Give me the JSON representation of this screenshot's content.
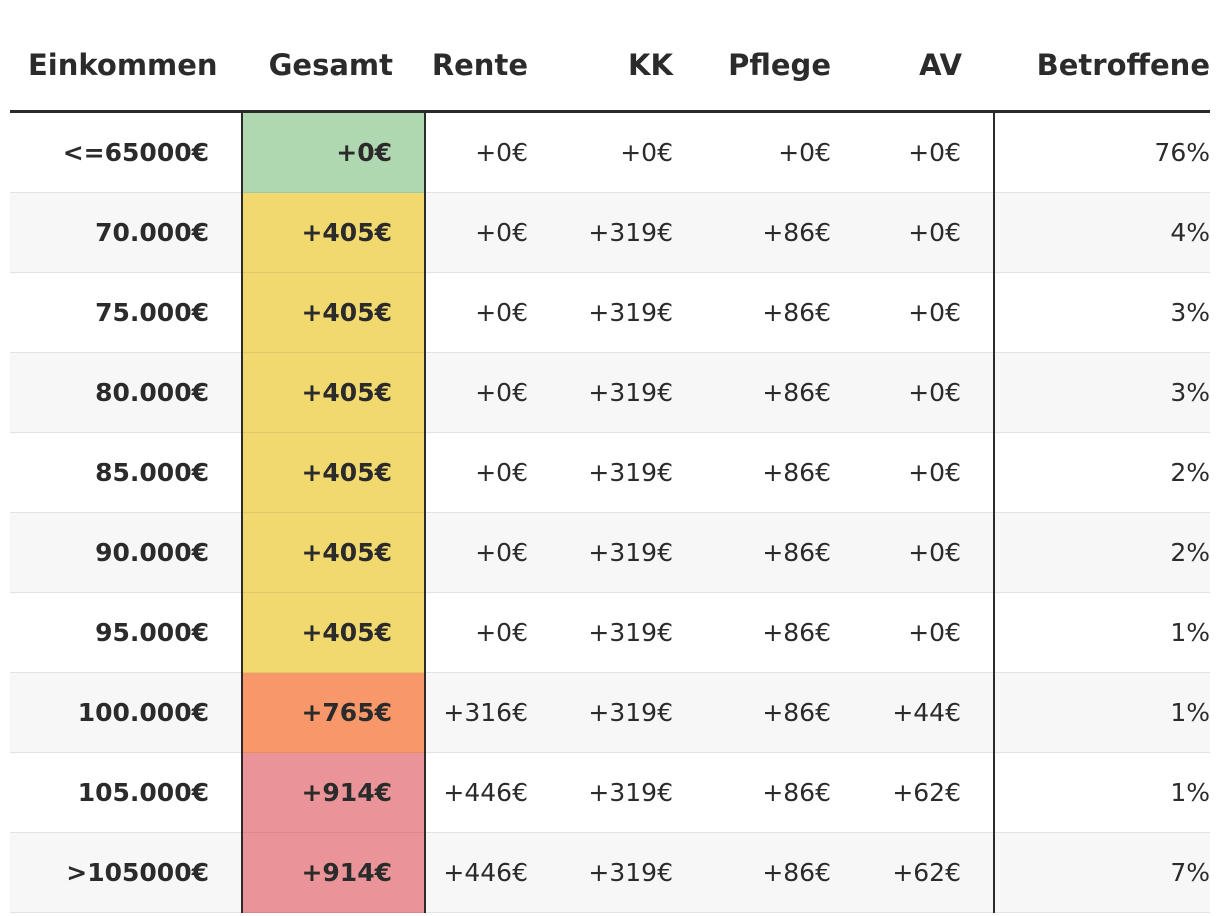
{
  "chart_data": {
    "type": "table",
    "columns": [
      "Einkommen",
      "Gesamt",
      "Rente",
      "KK",
      "Pflege",
      "AV",
      "Betroffene"
    ],
    "rows": [
      {
        "einkommen": "<=65000€",
        "gesamt": "+0€",
        "rente": "+0€",
        "kk": "+0€",
        "pflege": "+0€",
        "av": "+0€",
        "betroffene": "76%",
        "color": "#afd7b0"
      },
      {
        "einkommen": "70.000€",
        "gesamt": "+405€",
        "rente": "+0€",
        "kk": "+319€",
        "pflege": "+86€",
        "av": "+0€",
        "betroffene": "4%",
        "color": "#f1d86f"
      },
      {
        "einkommen": "75.000€",
        "gesamt": "+405€",
        "rente": "+0€",
        "kk": "+319€",
        "pflege": "+86€",
        "av": "+0€",
        "betroffene": "3%",
        "color": "#f1d86f"
      },
      {
        "einkommen": "80.000€",
        "gesamt": "+405€",
        "rente": "+0€",
        "kk": "+319€",
        "pflege": "+86€",
        "av": "+0€",
        "betroffene": "3%",
        "color": "#f1d86f"
      },
      {
        "einkommen": "85.000€",
        "gesamt": "+405€",
        "rente": "+0€",
        "kk": "+319€",
        "pflege": "+86€",
        "av": "+0€",
        "betroffene": "2%",
        "color": "#f1d86f"
      },
      {
        "einkommen": "90.000€",
        "gesamt": "+405€",
        "rente": "+0€",
        "kk": "+319€",
        "pflege": "+86€",
        "av": "+0€",
        "betroffene": "2%",
        "color": "#f1d86f"
      },
      {
        "einkommen": "95.000€",
        "gesamt": "+405€",
        "rente": "+0€",
        "kk": "+319€",
        "pflege": "+86€",
        "av": "+0€",
        "betroffene": "1%",
        "color": "#f1d86f"
      },
      {
        "einkommen": "100.000€",
        "gesamt": "+765€",
        "rente": "+316€",
        "kk": "+319€",
        "pflege": "+86€",
        "av": "+44€",
        "betroffene": "1%",
        "color": "#f8976a"
      },
      {
        "einkommen": "105.000€",
        "gesamt": "+914€",
        "rente": "+446€",
        "kk": "+319€",
        "pflege": "+86€",
        "av": "+62€",
        "betroffene": "1%",
        "color": "#ea9499"
      },
      {
        "einkommen": ">105000€",
        "gesamt": "+914€",
        "rente": "+446€",
        "kk": "+319€",
        "pflege": "+86€",
        "av": "+62€",
        "betroffene": "7%",
        "color": "#ea9499"
      }
    ]
  }
}
